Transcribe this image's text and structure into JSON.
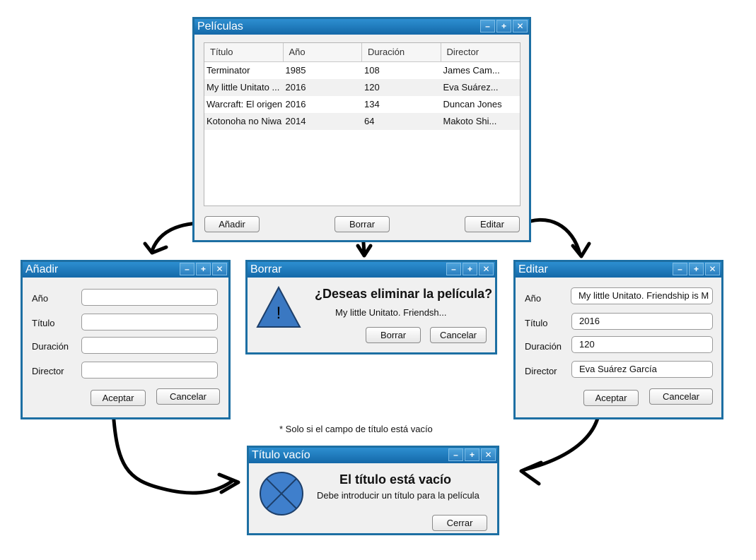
{
  "peliculas": {
    "title": "Películas",
    "columns": [
      "Título",
      "Año",
      "Duración",
      "Director"
    ],
    "rows": [
      [
        "Terminator",
        "1985",
        "108",
        "James Cam..."
      ],
      [
        "My little Unitato ...",
        "2016",
        "120",
        "Eva Suárez..."
      ],
      [
        "Warcraft: El origen",
        "2016",
        "134",
        "Duncan Jones"
      ],
      [
        "Kotonoha no Niwa",
        "2014",
        "64",
        "Makoto Shi..."
      ]
    ],
    "add_label": "Añadir",
    "delete_label": "Borrar",
    "edit_label": "Editar"
  },
  "window_controls": {
    "minimize": "–",
    "maximize": "+",
    "close": "✕"
  },
  "anadir": {
    "title": "Añadir",
    "labels": {
      "anio": "Año",
      "titulo": "Título",
      "duracion": "Duración",
      "director": "Director"
    },
    "values": {
      "anio": "",
      "titulo": "",
      "duracion": "",
      "director": ""
    },
    "accept_label": "Aceptar",
    "cancel_label": "Cancelar"
  },
  "borrar": {
    "title": "Borrar",
    "heading": "¿Deseas eliminar la película?",
    "subtext": "My little Unitato. Friendsh...",
    "icon_glyph": "!",
    "confirm_label": "Borrar",
    "cancel_label": "Cancelar"
  },
  "editar": {
    "title": "Editar",
    "labels": {
      "anio": "Año",
      "titulo": "Título",
      "duracion": "Duración",
      "director": "Director"
    },
    "values": {
      "anio": "My little Unitato. Friendship is M",
      "titulo": "2016",
      "duracion": "120",
      "director": "Eva Suárez García"
    },
    "accept_label": "Aceptar",
    "cancel_label": "Cancelar"
  },
  "note": "* Solo si el campo de título está vacío",
  "titulo_vacio": {
    "title": "Título vacío",
    "heading": "El título está vacío",
    "subtext": "Debe introducir un título para la película",
    "close_label": "Cerrar"
  },
  "colors": {
    "titlebar": "#1468a8",
    "border": "#1d6fa3",
    "warning_icon": "#3a78c2",
    "error_icon": "#3f7fcc"
  }
}
